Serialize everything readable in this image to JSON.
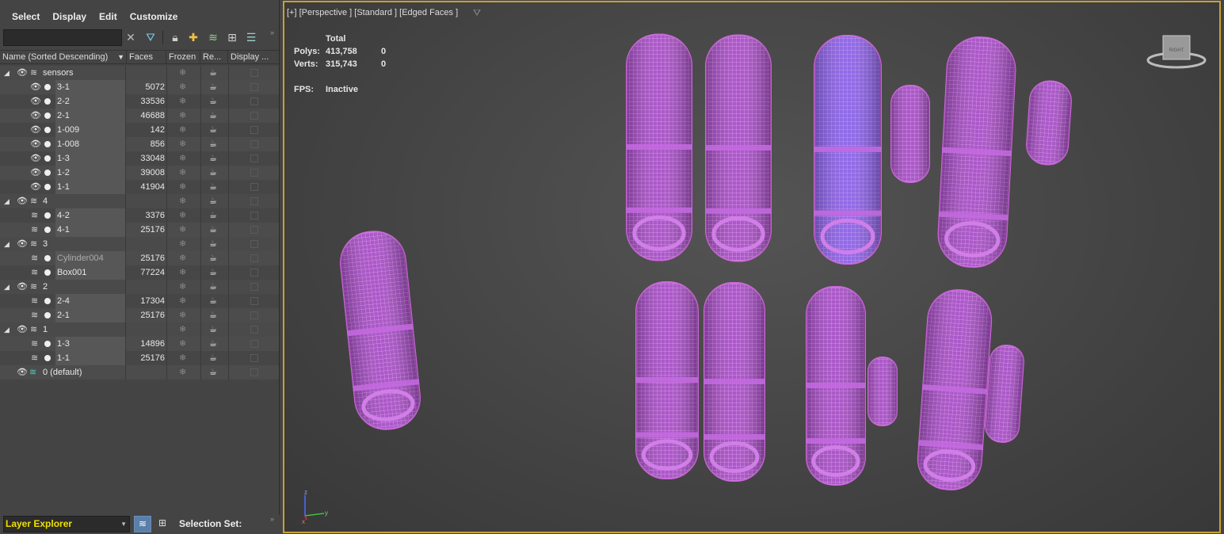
{
  "menu": [
    "Select",
    "Display",
    "Edit",
    "Customize"
  ],
  "search": {
    "value": ""
  },
  "toolbar_icons": [
    "clear-search-icon",
    "filter-icon",
    "lock-icon",
    "add-layer-icon",
    "layers-icon",
    "hierarchy-icon",
    "stack-icon"
  ],
  "columns": [
    {
      "label": "Name (Sorted Descending)"
    },
    {
      "label": "Faces"
    },
    {
      "label": "Frozen"
    },
    {
      "label": "Re..."
    },
    {
      "label": "Display ..."
    }
  ],
  "tree": [
    {
      "kind": "layer",
      "name": "sensors",
      "faces": ""
    },
    {
      "kind": "obj",
      "name": "3-1",
      "faces": "5072"
    },
    {
      "kind": "obj",
      "name": "2-2",
      "faces": "33536"
    },
    {
      "kind": "obj",
      "name": "2-1",
      "faces": "46688"
    },
    {
      "kind": "obj",
      "name": "1-009",
      "faces": "142"
    },
    {
      "kind": "obj",
      "name": "1-008",
      "faces": "856"
    },
    {
      "kind": "obj",
      "name": "1-3",
      "faces": "33048"
    },
    {
      "kind": "obj",
      "name": "1-2",
      "faces": "39008"
    },
    {
      "kind": "obj",
      "name": "1-1",
      "faces": "41904"
    },
    {
      "kind": "layer",
      "name": "4",
      "faces": ""
    },
    {
      "kind": "lobj",
      "name": "4-2",
      "faces": "3376"
    },
    {
      "kind": "lobj",
      "name": "4-1",
      "faces": "25176"
    },
    {
      "kind": "layer",
      "name": "3",
      "faces": ""
    },
    {
      "kind": "lobj",
      "name": "Cylinder004",
      "faces": "25176",
      "dim": true
    },
    {
      "kind": "lobj",
      "name": "Box001",
      "faces": "77224"
    },
    {
      "kind": "layer",
      "name": "2",
      "faces": ""
    },
    {
      "kind": "lobj",
      "name": "2-4",
      "faces": "17304"
    },
    {
      "kind": "lobj",
      "name": "2-1",
      "faces": "25176"
    },
    {
      "kind": "layer",
      "name": "1",
      "faces": ""
    },
    {
      "kind": "lobj",
      "name": "1-3",
      "faces": "14896"
    },
    {
      "kind": "lobj",
      "name": "1-1",
      "faces": "25176"
    },
    {
      "kind": "default",
      "name": "0 (default)",
      "faces": ""
    }
  ],
  "bottom": {
    "explorer_name": "Layer Explorer",
    "selection_set_label": "Selection Set:"
  },
  "viewport": {
    "label": "[+] [Perspective ] [Standard ] [Edged Faces ]",
    "stats": {
      "header": "Total",
      "polys_label": "Polys:",
      "polys_total": "413,758",
      "polys_sel": "0",
      "verts_label": "Verts:",
      "verts_total": "315,743",
      "verts_sel": "0",
      "fps_label": "FPS:",
      "fps_value": "Inactive"
    },
    "viewcube_label": "RIGHT",
    "axis_labels": {
      "x": "x",
      "y": "y",
      "z": "z"
    },
    "colors": {
      "wire": "#cc66dd",
      "fill": "#a04cc0",
      "highlight": "#8a66ff",
      "border": "#c8a032"
    }
  }
}
